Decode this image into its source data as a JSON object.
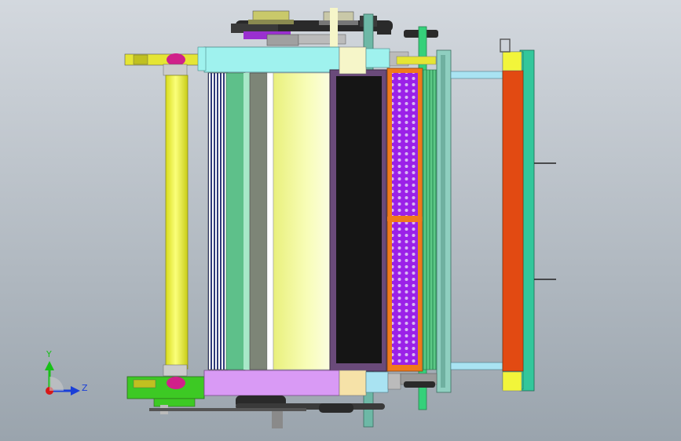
{
  "viewport": {
    "background_top": "#d3d8de",
    "background_bottom": "#9aa4ad"
  },
  "triad": {
    "y_label": "Y",
    "z_label": "Z",
    "y_color": "#18c018",
    "z_color": "#1a3fd8",
    "origin_color": "#d81818"
  },
  "colors": {
    "roller_yellow": "#f2f53a",
    "cyan_block": "#9ff2ee",
    "purple_block": "#d99af5",
    "orange_frame": "#f07a1a",
    "purple_grid": "#a020f0",
    "red_panel": "#e24a12",
    "teal_panel": "#33c79b",
    "green_drum": "#5ec08a",
    "dark_panel": "#151515",
    "plum_frame": "#6a4a7a",
    "gray_drum": "#7d8577",
    "pale_yellow_drum": "#f4fb9a",
    "navy_bars": "#2f3a7a",
    "light_blue": "#a9e3f2",
    "green_shaft": "#35d17a",
    "bright_green": "#3dc924"
  }
}
